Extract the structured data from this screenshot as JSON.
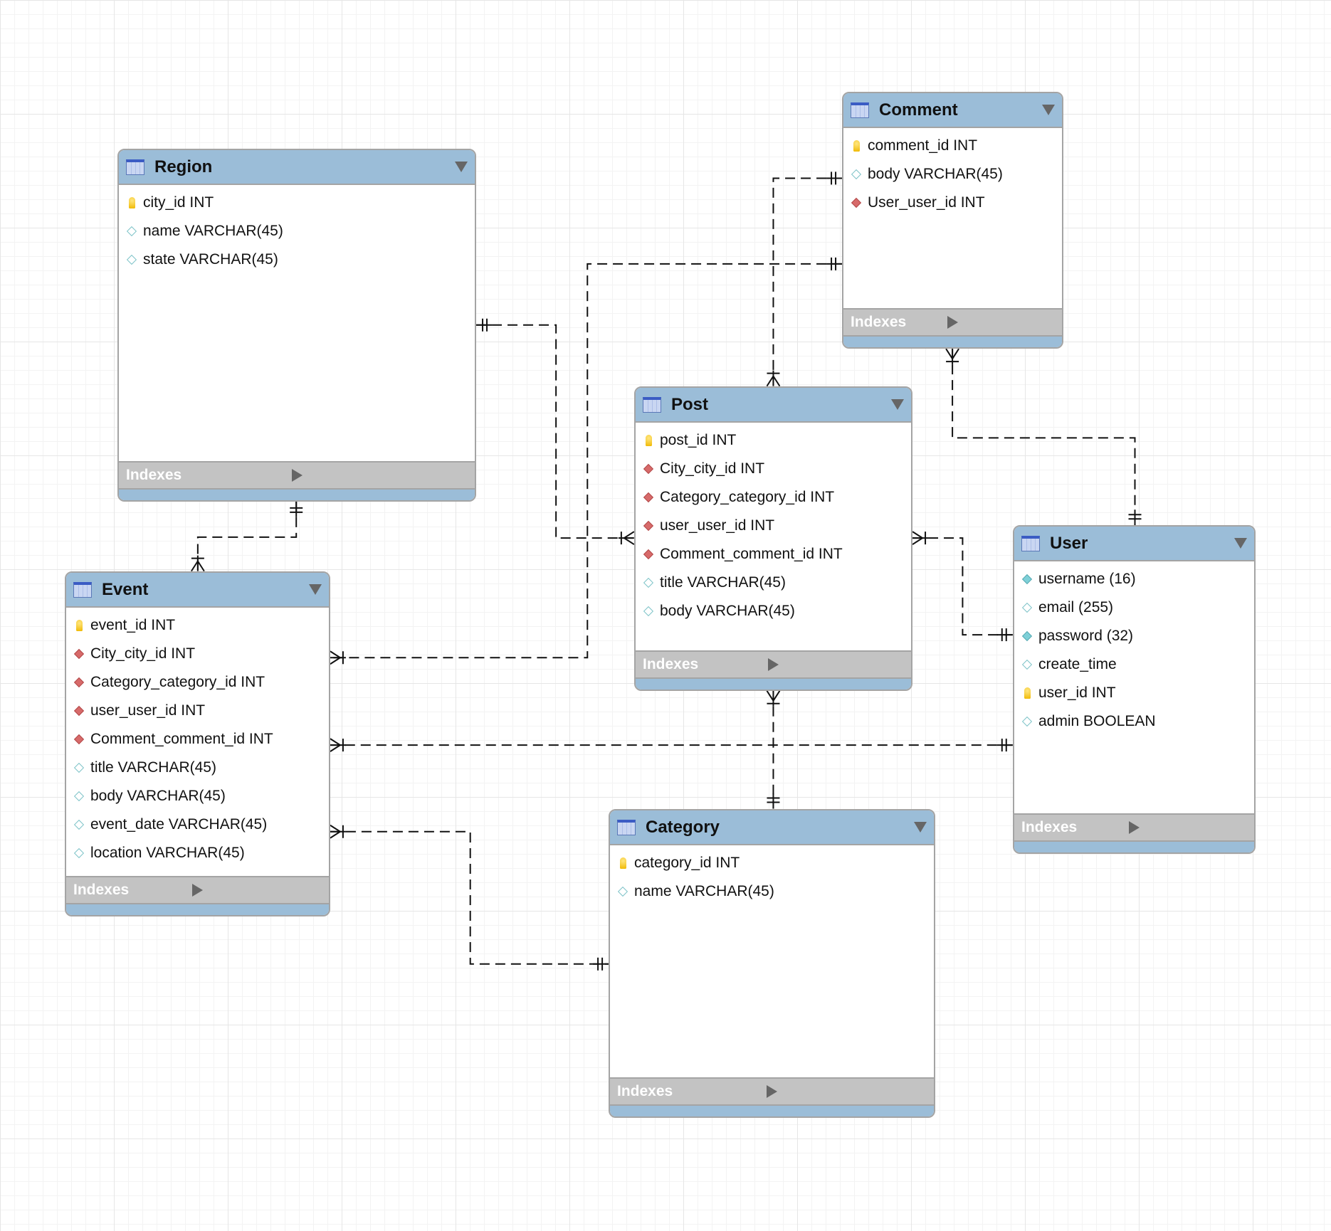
{
  "indexes_label": "Indexes",
  "colors": {
    "header": "#9bbdd8",
    "indexes_bar": "#c3c3c3",
    "foreign_key": "#d76a6a",
    "column": "#7ec3c8",
    "primary_key": "#f0b800"
  },
  "tables": [
    {
      "id": "region",
      "name": "Region",
      "columns": [
        {
          "text": "city_id INT",
          "icon": "key-icon"
        },
        {
          "text": "name VARCHAR(45)",
          "icon": "column-diamond-icon"
        },
        {
          "text": "state VARCHAR(45)",
          "icon": "column-diamond-icon"
        }
      ]
    },
    {
      "id": "comment",
      "name": "Comment",
      "columns": [
        {
          "text": "comment_id INT",
          "icon": "key-icon"
        },
        {
          "text": "body VARCHAR(45)",
          "icon": "column-diamond-icon"
        },
        {
          "text": "User_user_id INT",
          "icon": "foreign-key-icon"
        }
      ]
    },
    {
      "id": "post",
      "name": "Post",
      "columns": [
        {
          "text": "post_id INT",
          "icon": "key-icon"
        },
        {
          "text": "City_city_id INT",
          "icon": "foreign-key-icon"
        },
        {
          "text": "Category_category_id INT",
          "icon": "foreign-key-icon"
        },
        {
          "text": "user_user_id INT",
          "icon": "foreign-key-icon"
        },
        {
          "text": "Comment_comment_id INT",
          "icon": "foreign-key-icon"
        },
        {
          "text": "title VARCHAR(45)",
          "icon": "column-diamond-icon"
        },
        {
          "text": "body VARCHAR(45)",
          "icon": "column-diamond-icon"
        }
      ]
    },
    {
      "id": "user",
      "name": "User",
      "columns": [
        {
          "text": "username (16)",
          "icon": "not-null-diamond-icon"
        },
        {
          "text": "email (255)",
          "icon": "column-diamond-icon"
        },
        {
          "text": "password (32)",
          "icon": "not-null-diamond-icon"
        },
        {
          "text": "create_time",
          "icon": "column-diamond-icon"
        },
        {
          "text": "user_id INT",
          "icon": "key-icon"
        },
        {
          "text": "admin BOOLEAN",
          "icon": "column-diamond-icon"
        }
      ]
    },
    {
      "id": "event",
      "name": "Event",
      "columns": [
        {
          "text": "event_id INT",
          "icon": "key-icon"
        },
        {
          "text": "City_city_id INT",
          "icon": "foreign-key-icon"
        },
        {
          "text": "Category_category_id INT",
          "icon": "foreign-key-icon"
        },
        {
          "text": "user_user_id INT",
          "icon": "foreign-key-icon"
        },
        {
          "text": "Comment_comment_id INT",
          "icon": "foreign-key-icon"
        },
        {
          "text": "title VARCHAR(45)",
          "icon": "column-diamond-icon"
        },
        {
          "text": "body VARCHAR(45)",
          "icon": "column-diamond-icon"
        },
        {
          "text": "event_date VARCHAR(45)",
          "icon": "column-diamond-icon"
        },
        {
          "text": "location VARCHAR(45)",
          "icon": "column-diamond-icon"
        }
      ]
    },
    {
      "id": "category",
      "name": "Category",
      "columns": [
        {
          "text": "category_id INT",
          "icon": "key-icon"
        },
        {
          "text": "name VARCHAR(45)",
          "icon": "column-diamond-icon"
        }
      ]
    }
  ],
  "relationships": [
    {
      "from": "Region",
      "from_card": "one",
      "to": "Post",
      "to_card": "many"
    },
    {
      "from": "Comment",
      "from_card": "one",
      "to": "Event",
      "to_card": "many"
    },
    {
      "from": "Comment",
      "from_card": "one",
      "to": "Post",
      "to_card": "many"
    },
    {
      "from": "User",
      "from_card": "one",
      "to": "Comment",
      "to_card": "many"
    },
    {
      "from": "User",
      "from_card": "one",
      "to": "Post",
      "to_card": "many"
    },
    {
      "from": "User",
      "from_card": "one",
      "to": "Event",
      "to_card": "many"
    },
    {
      "from": "Category",
      "from_card": "one",
      "to": "Post",
      "to_card": "many"
    },
    {
      "from": "Category",
      "from_card": "one",
      "to": "Event",
      "to_card": "many"
    },
    {
      "from": "Region",
      "from_card": "one",
      "to": "Event",
      "to_card": "many"
    }
  ]
}
